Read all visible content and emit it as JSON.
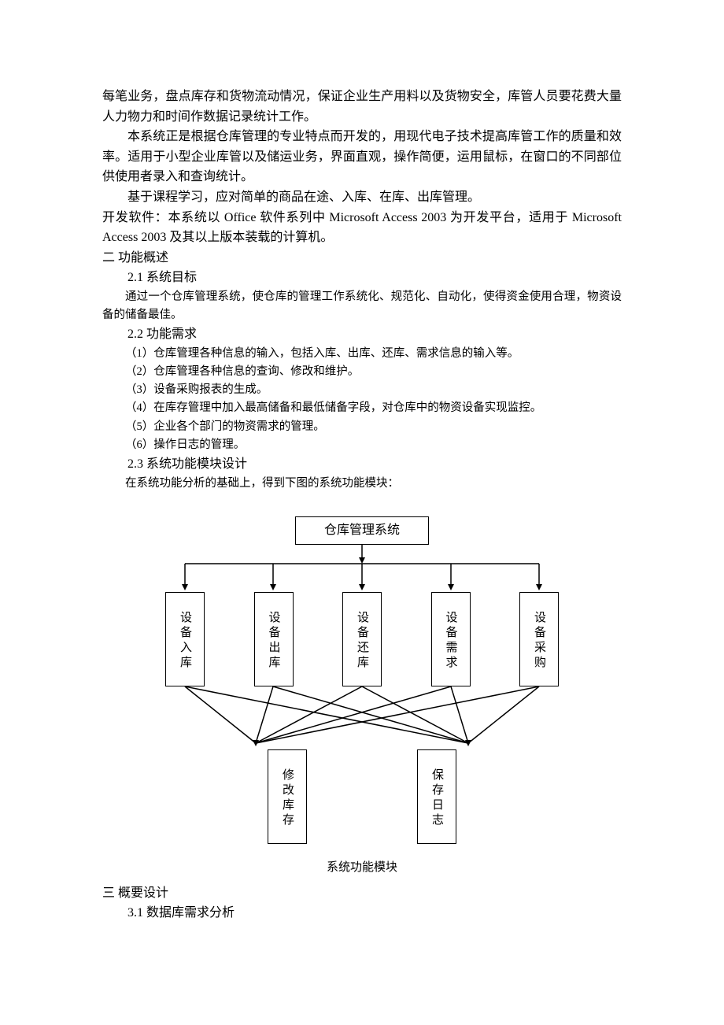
{
  "paragraphs": {
    "p1": "每笔业务，盘点库存和货物流动情况，保证企业生产用料以及货物安全，库管人员要花费大量人力物力和时间作数据记录统计工作。",
    "p2": "本系统正是根据仓库管理的专业特点而开发的，用现代电子技术提高库管工作的质量和效率。适用于小型企业库管以及储运业务，界面直观，操作简便，运用鼠标，在窗口的不同部位供使用者录入和查询统计。",
    "p3": "基于课程学习，应对简单的商品在途、入库、在库、出库管理。",
    "p4": "开发软件：本系统以 Office 软件系列中 Microsoft Access 2003 为开发平台，适用于 Microsoft Access 2003 及其以上版本装载的计算机。"
  },
  "sections": {
    "s2_title": "二  功能概述",
    "s2_1_title": "2.1 系统目标",
    "s2_1_body": "通过一个仓库管理系统，使仓库的管理工作系统化、规范化、自动化，使得资金使用合理，物资设备的储备最佳。",
    "s2_2_title": "2.2 功能需求",
    "s2_2_items": [
      "（1）仓库管理各种信息的输入，包括入库、出库、还库、需求信息的输入等。",
      "（2）仓库管理各种信息的查询、修改和维护。",
      "（3）设备采购报表的生成。",
      "（4）在库存管理中加入最高储备和最低储备字段，对仓库中的物资设备实现监控。",
      "（5）企业各个部门的物资需求的管理。",
      "（6）操作日志的管理。"
    ],
    "s2_3_title": "2.3  系统功能模块设计",
    "s2_3_body": "在系统功能分析的基础上，得到下图的系统功能模块：",
    "s3_title": "三  概要设计",
    "s3_1_title": "3.1  数据库需求分析"
  },
  "diagram": {
    "root": "仓库管理系统",
    "level2": [
      "设备入库",
      "设备出库",
      "设备还库",
      "设备需求",
      "设备采购"
    ],
    "level3": [
      "修改库存",
      "保存日志"
    ],
    "caption": "系统功能模块"
  }
}
